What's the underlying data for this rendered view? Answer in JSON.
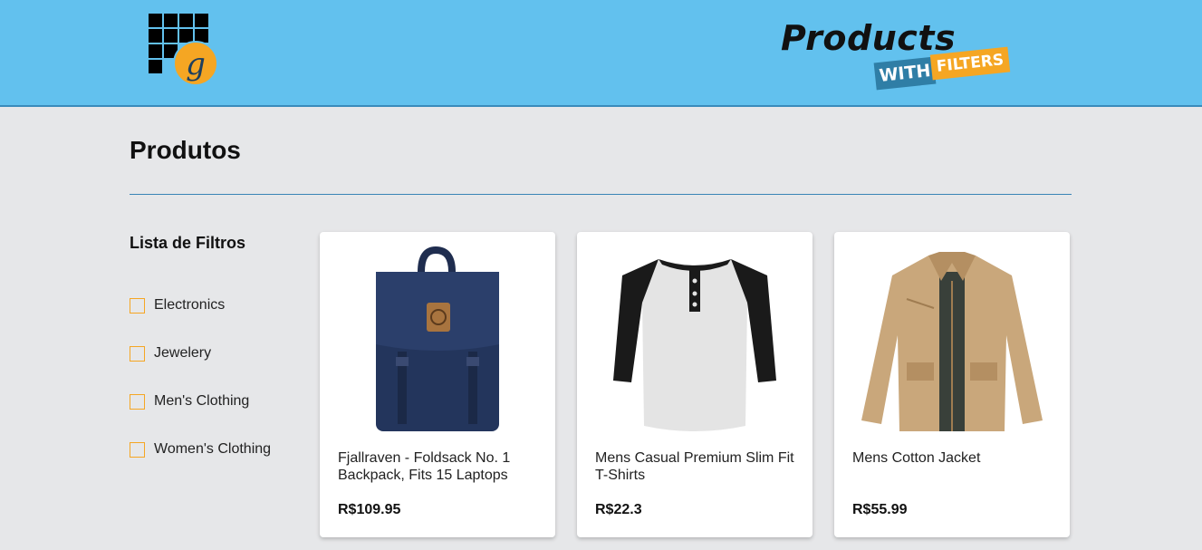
{
  "header": {
    "brand_title": "Products",
    "brand_with": "WITH",
    "brand_filters": "FILTERS",
    "logo_letter": "g",
    "colors": {
      "bar": "#62c1ee",
      "accent": "#f5a623",
      "blue": "#2f7ea6"
    }
  },
  "main": {
    "title": "Produtos"
  },
  "filters": {
    "title": "Lista de Filtros",
    "items": [
      {
        "label": "Electronics",
        "checked": false
      },
      {
        "label": "Jewelery",
        "checked": false
      },
      {
        "label": "Men's Clothing",
        "checked": false
      },
      {
        "label": "Women's Clothing",
        "checked": false
      }
    ]
  },
  "products": [
    {
      "name": "Fjallraven - Foldsack No. 1 Backpack, Fits 15 Laptops",
      "price": "R$109.95",
      "image_icon": "backpack-image"
    },
    {
      "name": "Mens Casual Premium Slim Fit T-Shirts",
      "price": "R$22.3",
      "image_icon": "tshirt-image"
    },
    {
      "name": "Mens Cotton Jacket",
      "price": "R$55.99",
      "image_icon": "jacket-image"
    }
  ]
}
